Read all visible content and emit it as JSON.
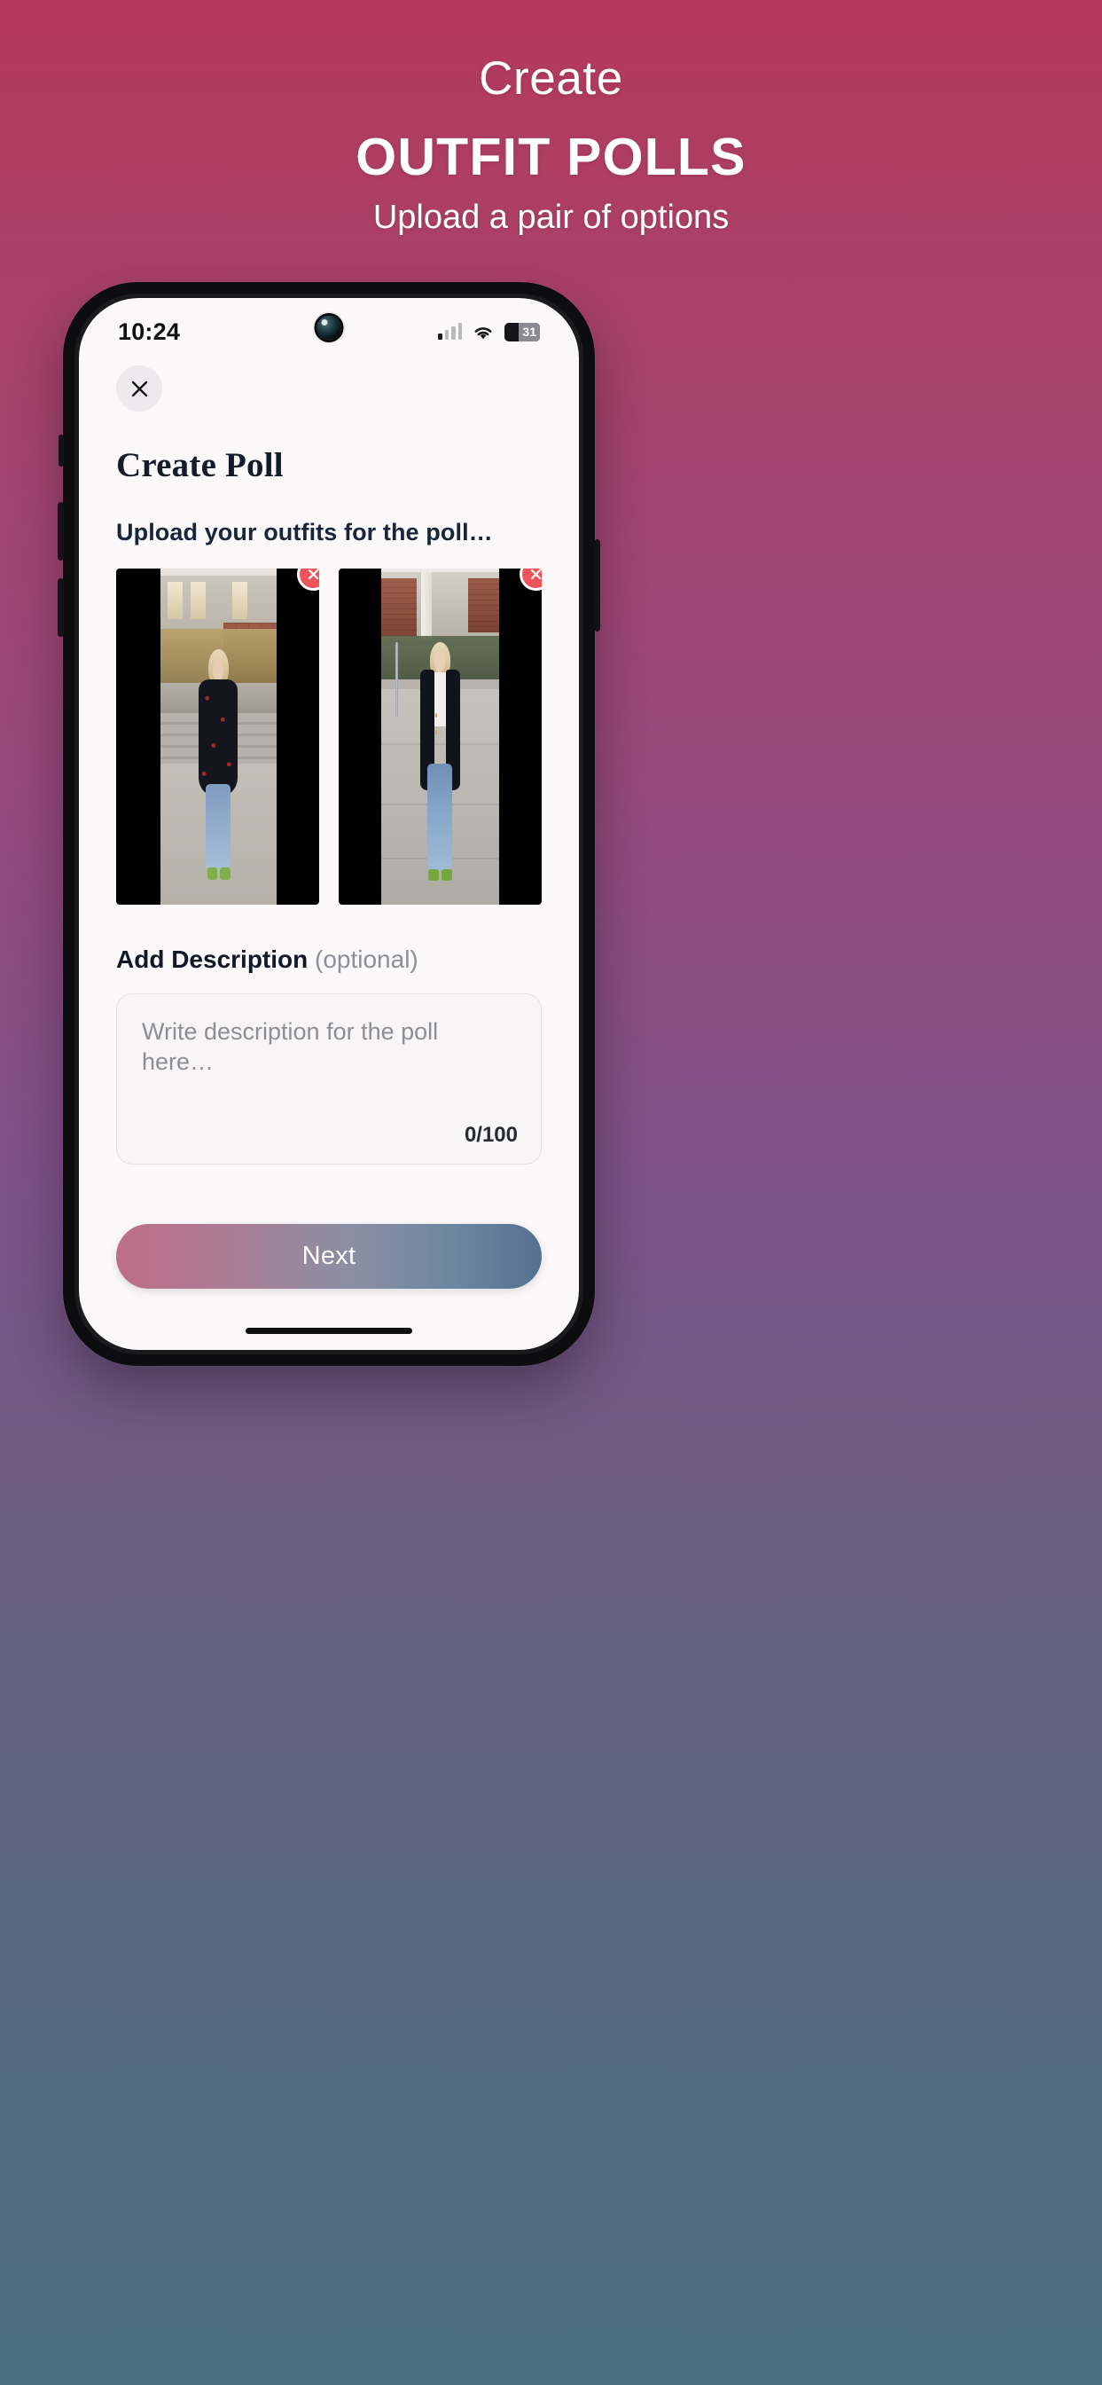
{
  "promo": {
    "eyebrow": "Create",
    "title": "OUTFIT POLLS",
    "subtitle": "Upload a pair of options",
    "bg_top_color": "#b4395b",
    "bg_bottom_color": "#4a6e84"
  },
  "statusbar": {
    "time": "10:24",
    "signal_icon": "cellular-signal-icon",
    "wifi_icon": "wifi-icon",
    "battery_level": "31",
    "battery_icon": "battery-icon"
  },
  "app": {
    "close_icon": "close-icon",
    "page_title": "Create Poll",
    "upload_label": "Upload your outfits for the poll…",
    "photos": [
      {
        "name": "outfit-option-1",
        "alt": "Woman in polka-dot cape and light blue jeans",
        "remove_icon": "remove-icon"
      },
      {
        "name": "outfit-option-2",
        "alt": "Woman in navy blazer, white shirt and blue jeans",
        "remove_icon": "remove-icon"
      }
    ],
    "description": {
      "label_bold": "Add Description",
      "label_optional": "(optional)",
      "placeholder": "Write description for the poll here…",
      "value": "",
      "counter": "0/100",
      "max_length": "100"
    },
    "next_label": "Next",
    "accent_red": "#f0545b",
    "title_color": "#131c2b"
  }
}
